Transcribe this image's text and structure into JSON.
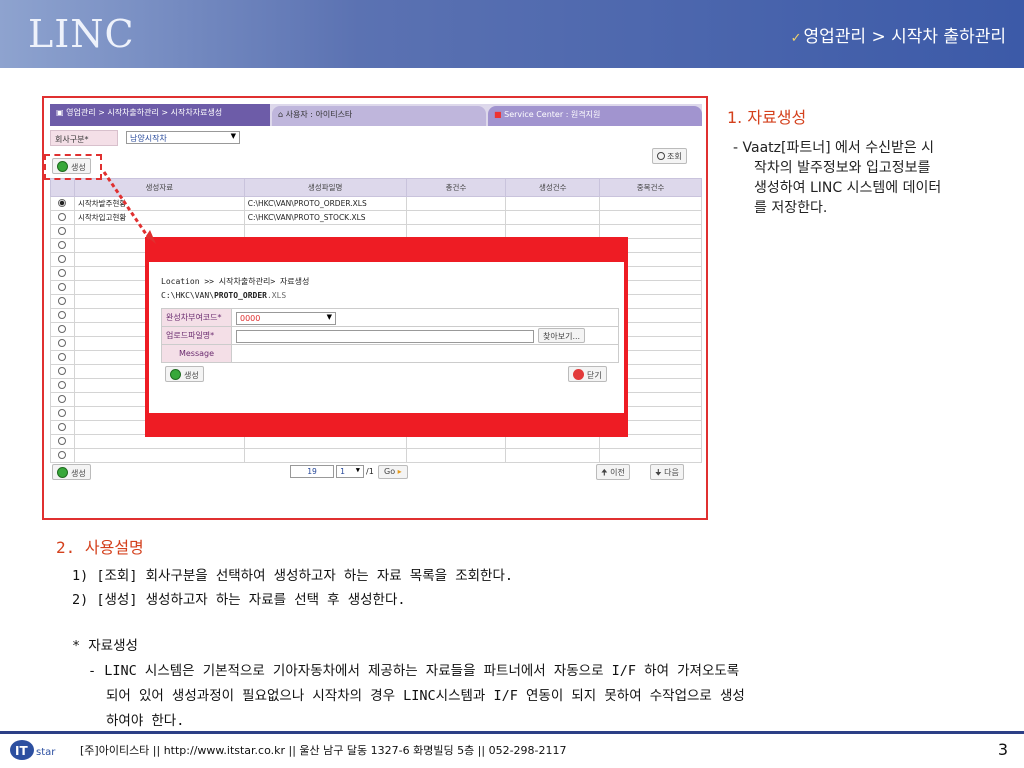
{
  "header": {
    "logo": "LINC",
    "breadcrumb": "영업관리 > 시작차 출하관리"
  },
  "screen": {
    "menu_tab": "영업관리 > 시작차출하관리 > 시작차자료생성",
    "user_tab": "사용자 : 아이티스타",
    "service_tab": "Service Center : 원격지원",
    "company_label": "회사구분*",
    "company_value": "남양시작차",
    "generate_label": "생성",
    "search_label": "조회",
    "columns": [
      "생성자료",
      "생성파일명",
      "총건수",
      "생성건수",
      "중복건수"
    ],
    "rows": [
      {
        "data": "시작차발주현황",
        "file": "C:\\HKC\\VAN\\PROTO_ORDER.XLS"
      },
      {
        "data": "시작차입고현황",
        "file": "C:\\HKC\\VAN\\PROTO_STOCK.XLS"
      }
    ],
    "page_current": "19",
    "page_select": "1",
    "page_total": "/1",
    "go_label": "Go",
    "prev_label": "이전",
    "next_label": "다음"
  },
  "popup": {
    "location": "Location >> 시작차출하관리> 자료생성",
    "path_prefix": "C:\\HKC\\VAN\\",
    "path_bold": "PROTO_ORDER",
    "path_ext": ".XLS",
    "code_label": "완성차부여코드*",
    "code_value": "0000",
    "upload_label": "업로드파일명*",
    "browse_label": "찾아보기...",
    "message_label": "Message",
    "generate_label": "생성",
    "close_label": "닫기"
  },
  "note": {
    "title": "1. 자료생성",
    "line1": "- Vaatz[파트너] 에서 수신받은 시",
    "line2": "작차의 발주정보와 입고정보를",
    "line3": "생성하여 LINC 시스템에 데이터",
    "line4": "를 저장한다."
  },
  "usage": {
    "title": "2. 사용설명",
    "line1": "1) [조회] 회사구분을 선택하여 생성하고자 하는 자료 목록을 조회한다.",
    "line2": "2) [생성] 생성하고자 하는 자료를 선택 후 생성한다.",
    "star_title": "* 자료생성",
    "desc1": "- LINC 시스템은 기본적으로 기아자동차에서 제공하는 자료들을 파트너에서 자동으로 I/F 하여 가져오도록",
    "desc2": "되어 있어 생성과정이 필요없으나 시작차의 경우 LINC시스템과 I/F 연동이 되지 못하여 수작업으로 생성",
    "desc3": "하여야 한다."
  },
  "footer": {
    "logo_text": "IT star",
    "text": "[주]아이티스타 || http://www.itstar.co.kr || 울산 남구 달동 1327-6 화명빌딩 5층 || 052-298-2117",
    "page": "3"
  }
}
